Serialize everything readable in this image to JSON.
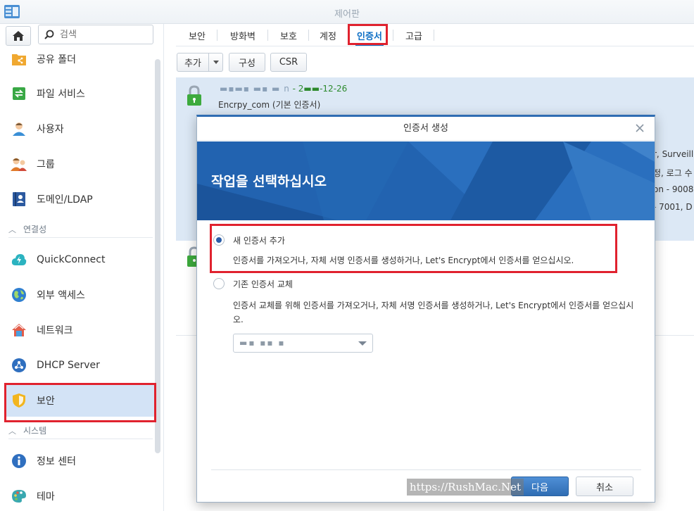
{
  "window": {
    "title": "제어판"
  },
  "sidebar": {
    "search_placeholder": "검색",
    "items": [
      {
        "label": "공유 폴더",
        "icon": "shared-folder-icon"
      },
      {
        "label": "파일 서비스",
        "icon": "file-services-icon"
      },
      {
        "label": "사용자",
        "icon": "user-icon"
      },
      {
        "label": "그룹",
        "icon": "group-icon"
      },
      {
        "label": "도메인/LDAP",
        "icon": "domain-ldap-icon"
      }
    ],
    "section_connectivity": "연결성",
    "connectivity_items": [
      {
        "label": "QuickConnect",
        "icon": "quickconnect-icon"
      },
      {
        "label": "외부 액세스",
        "icon": "external-access-icon"
      },
      {
        "label": "네트워크",
        "icon": "network-icon"
      },
      {
        "label": "DHCP Server",
        "icon": "dhcp-server-icon"
      },
      {
        "label": "보안",
        "icon": "security-shield-icon"
      }
    ],
    "section_system": "시스템",
    "system_items": [
      {
        "label": "정보 센터",
        "icon": "info-center-icon"
      },
      {
        "label": "테마",
        "icon": "theme-palette-icon"
      }
    ]
  },
  "tabs": [
    "보안",
    "방화벽",
    "보호",
    "계정",
    "인증서",
    "고급"
  ],
  "active_tab": "인증서",
  "toolbar": {
    "add": "추가",
    "configure": "구성",
    "csr": "CSR"
  },
  "certificate": {
    "name_masked": "▬▪▬▪ ▬▪ ▬ n",
    "date_text": "- 2▬▬-12-26",
    "subtitle": "Encrpy_com (기본 인증서)"
  },
  "right_fragments": [
    "r, Surveill",
    "정, 로그 수",
    "on - 9008",
    "- 7001, D"
  ],
  "dialog": {
    "title": "인증서 생성",
    "banner_heading": "작업을 선택하십시오",
    "option_new_label": "새 인증서 추가",
    "option_new_desc": "인증서를 가져오거나, 자체 서명 인증서를 생성하거나, Let's Encrypt에서 인증서를 얻으십시오.",
    "option_replace_label": "기존 인증서 교체",
    "option_replace_desc": "인증서 교체를 위해 인증서를 가져오거나, 자체 서명 인증서를 생성하거나, Let's Encrypt에서 인증서를 얻으십시오.",
    "select_value_masked": "▬▪ ▪▪ ▪",
    "next_button": "다음",
    "cancel_button": "취소"
  },
  "watermark": "https://RushMac.Net",
  "colors": {
    "accent": "#2f6db3",
    "highlight_red": "#e0222e",
    "active_row": "#d3e3f6",
    "lock_green": "#3daa3d"
  }
}
